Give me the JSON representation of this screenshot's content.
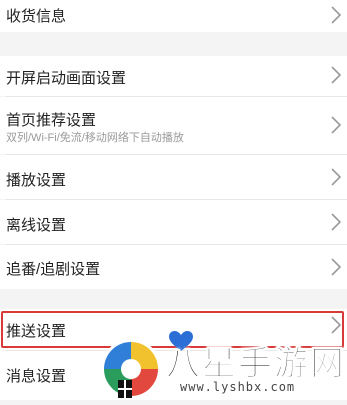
{
  "settings": {
    "shipping_info": "收货信息",
    "splash_screen": "开屏启动画面设置",
    "home_recommend": "首页推荐设置",
    "home_recommend_sub": "双列/Wi-Fi/免流/移动网络下自动播放",
    "playback": "播放设置",
    "offline": "离线设置",
    "follow": "追番/追剧设置",
    "push": "推送设置",
    "messages": "消息设置"
  },
  "watermark": {
    "brand": "八星手游网",
    "url": "www.lyshbx.com"
  },
  "colors": {
    "highlight": "#d83a3a",
    "background": "#f4f4f4"
  },
  "icons": {
    "chevron": "chevron-right-icon"
  }
}
